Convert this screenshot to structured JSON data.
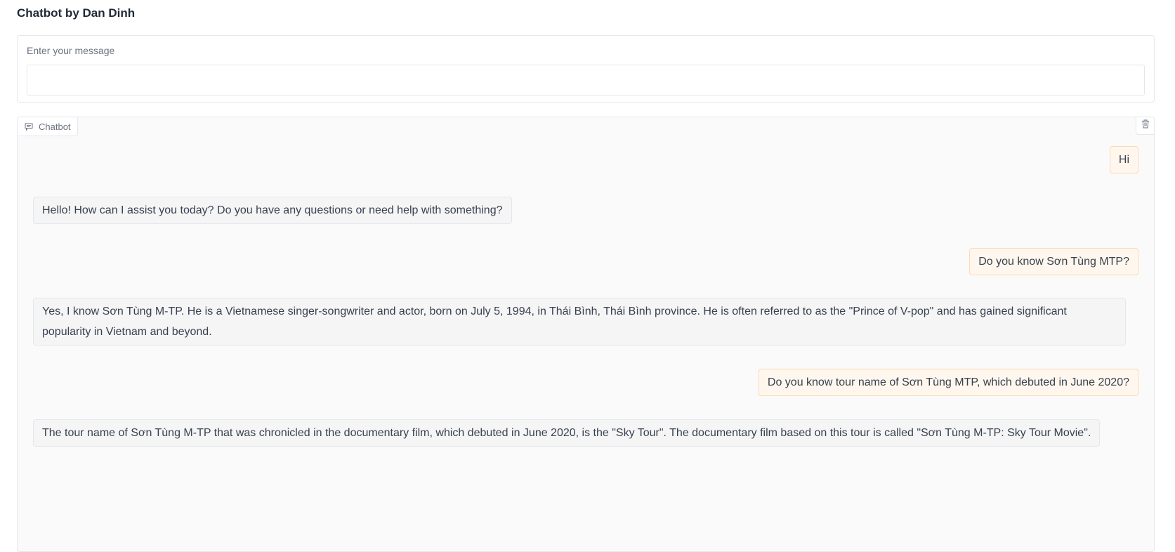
{
  "app": {
    "title": "Chatbot by Dan Dinh"
  },
  "input": {
    "label": "Enter your message",
    "value": "",
    "placeholder": ""
  },
  "chatbot": {
    "tab_label": "Chatbot",
    "tab_icon": "chat-icon",
    "clear_icon": "trash-icon",
    "messages": [
      {
        "role": "user",
        "text": "Hi"
      },
      {
        "role": "bot",
        "text": "Hello! How can I assist you today? Do you have any questions or need help with something?"
      },
      {
        "role": "user",
        "text": "Do you know Sơn Tùng MTP?"
      },
      {
        "role": "bot",
        "text": "Yes, I know Sơn Tùng M-TP. He is a Vietnamese singer-songwriter and actor, born on July 5, 1994, in Thái Bình, Thái Bình province. He is often referred to as the \"Prince of V-pop\" and has gained significant popularity in Vietnam and beyond."
      },
      {
        "role": "user",
        "text": "Do you know tour name of Sơn Tùng MTP, which debuted in June 2020?"
      },
      {
        "role": "bot",
        "text": "The tour name of Sơn Tùng M-TP that was chronicled in the documentary film, which debuted in June 2020, is the \"Sky Tour\". The documentary film based on this tour is called \"Sơn Tùng M-TP: Sky Tour Movie\"."
      }
    ]
  },
  "colors": {
    "user_bubble_bg": "#fff7ed",
    "user_bubble_border": "#fcd9b0",
    "bot_bubble_bg": "#f5f5f5",
    "panel_bg": "#fafafa"
  }
}
